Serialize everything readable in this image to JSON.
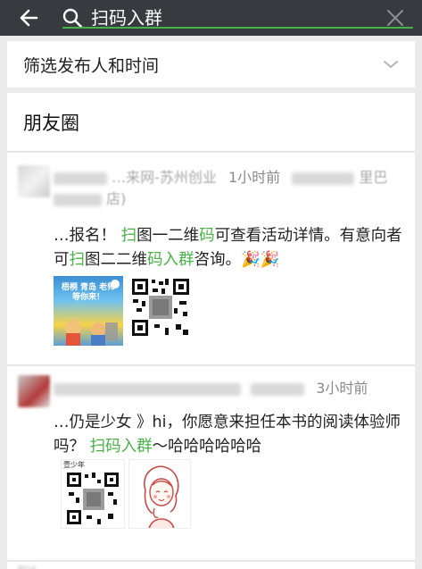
{
  "header": {
    "back_icon": "arrow-left-icon",
    "search_icon": "search-icon",
    "clear_icon": "close-icon",
    "search_value": "扫码入群",
    "accent_color": "#47b347"
  },
  "filter": {
    "label": "筛选发布人和时间",
    "chevron_icon": "chevron-down-icon"
  },
  "moments": {
    "title": "朋友圈",
    "posts": [
      {
        "author": "…来网-苏州创业",
        "time": "1小时前",
        "location_fragment_1": "里巴",
        "location_fragment_2": "店)",
        "content_parts": [
          "…报名！",
          "扫",
          "图一二维",
          "码",
          "可查看活动详情。有意向者可",
          "扫",
          "图二二维",
          "码入群",
          "咨询。",
          "🎉🎉"
        ],
        "poster_text": "梧桐 青岛 老师 等你来！"
      },
      {
        "author": "…",
        "time": "3小时前",
        "content_parts": [
          "…仍是少女 》hi，你愿意来担任本书的阅读体验师吗？",
          "扫码入群",
          "～哈哈哈哈哈哈"
        ],
        "qr_header": "壹少年"
      }
    ]
  }
}
